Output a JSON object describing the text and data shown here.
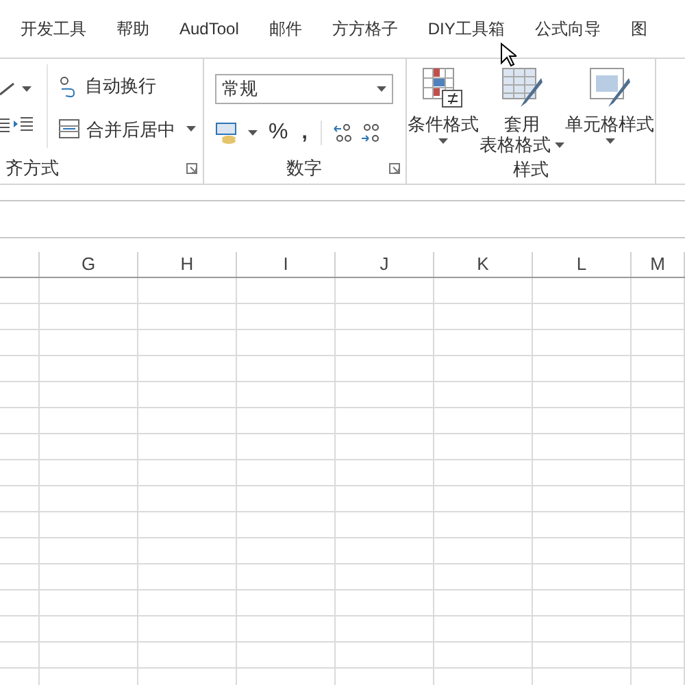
{
  "tabs": [
    {
      "label": "开发工具"
    },
    {
      "label": "帮助"
    },
    {
      "label": "AudTool"
    },
    {
      "label": "邮件"
    },
    {
      "label": "方方格子"
    },
    {
      "label": "DIY工具箱"
    },
    {
      "label": "公式向导"
    },
    {
      "label": "图"
    }
  ],
  "alignment_group": {
    "label": "齐方式",
    "wrap_button": "自动换行",
    "merge_button": "合并后居中"
  },
  "number_group": {
    "label": "数字",
    "format_field": {
      "value": "常规"
    },
    "percent_button": "%",
    "comma_button": ","
  },
  "styles_group": {
    "label": "样式",
    "buttons": [
      {
        "lines": [
          "条件格式"
        ],
        "kind": "conditional"
      },
      {
        "lines": [
          "套用",
          "表格格式"
        ],
        "kind": "table"
      },
      {
        "lines": [
          "单元格样式"
        ],
        "kind": "cell"
      }
    ]
  },
  "columns": [
    "G",
    "H",
    "I",
    "J",
    "K",
    "L",
    "M"
  ]
}
